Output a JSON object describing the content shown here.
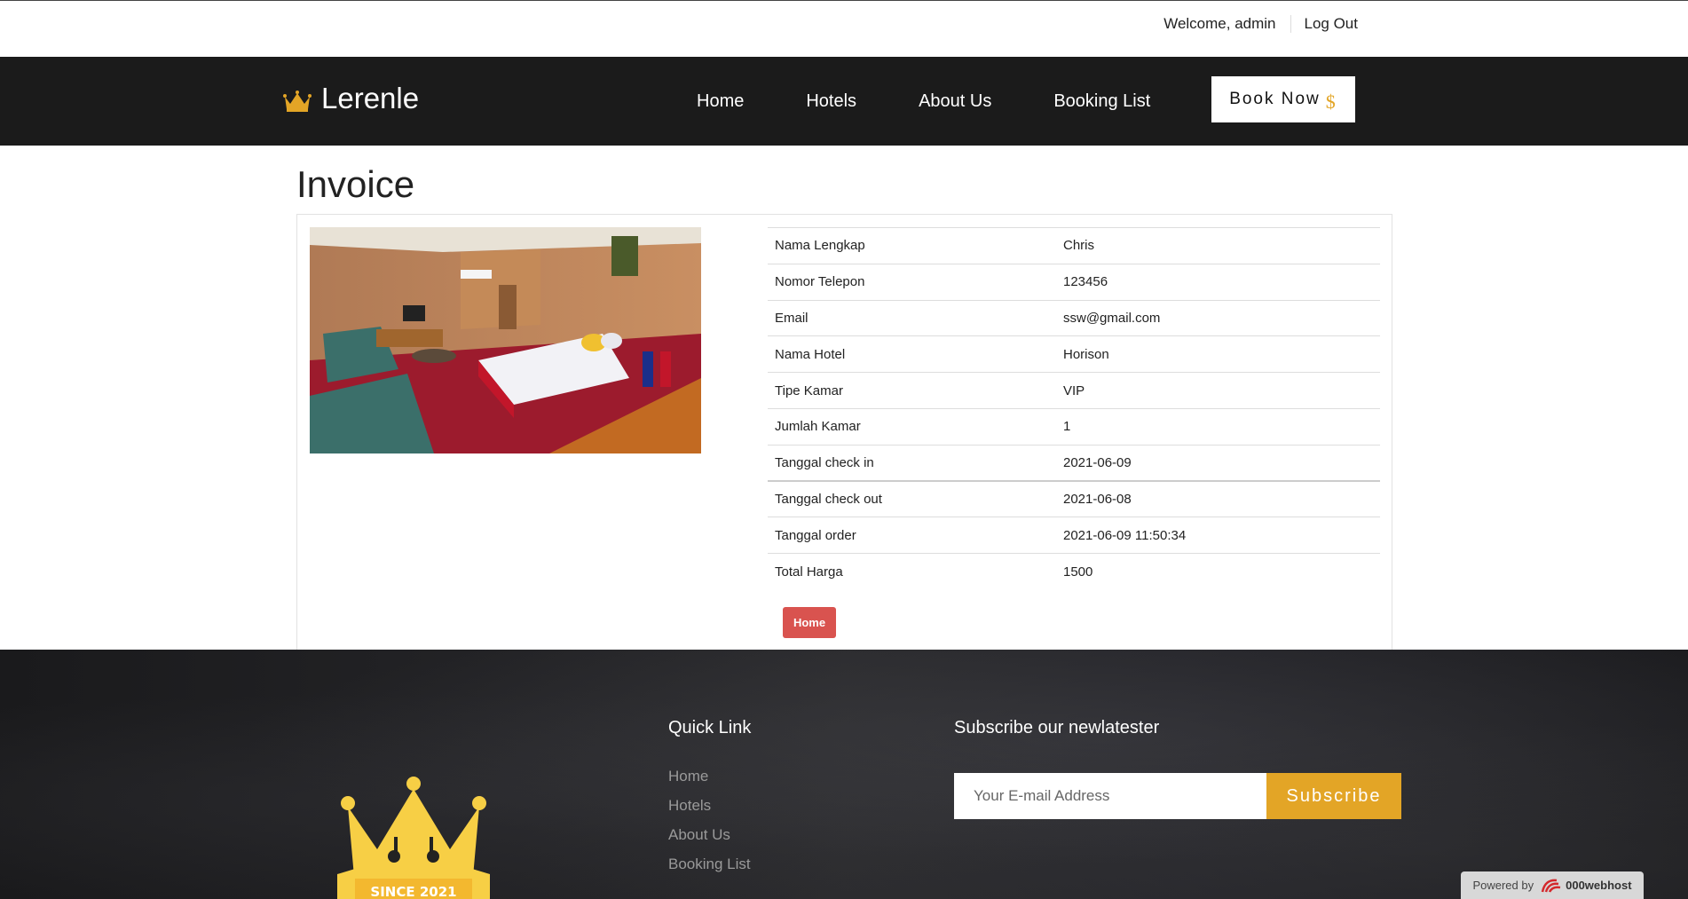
{
  "topbar": {
    "welcome": "Welcome, admin",
    "logout": "Log Out"
  },
  "nav": {
    "brand": "Lerenle",
    "links": [
      "Home",
      "Hotels",
      "About Us",
      "Booking List"
    ],
    "book_now": "Book Now",
    "book_now_icon": "$"
  },
  "page": {
    "title": "Invoice"
  },
  "invoice": {
    "rows": [
      {
        "label": "Nama Lengkap",
        "value": "Chris"
      },
      {
        "label": "Nomor Telepon",
        "value": "123456"
      },
      {
        "label": "Email",
        "value": "ssw@gmail.com"
      },
      {
        "label": "Nama Hotel",
        "value": "Horison"
      },
      {
        "label": "Tipe Kamar",
        "value": "VIP"
      },
      {
        "label": "Jumlah Kamar",
        "value": "1"
      },
      {
        "label": "Tanggal check in",
        "value": "2021-06-09"
      },
      {
        "label": "Tanggal check out",
        "value": "2021-06-08"
      },
      {
        "label": "Tanggal order",
        "value": "2021-06-09 11:50:34"
      },
      {
        "label": "Total Harga",
        "value": "1500"
      }
    ],
    "home_button": "Home"
  },
  "footer": {
    "logo_text": "SINCE 2021",
    "quick_link_title": "Quick Link",
    "quick_links": [
      "Home",
      "Hotels",
      "About Us",
      "Booking List"
    ],
    "subscribe_title": "Subscribe our newlatester",
    "email_placeholder": "Your E-mail Address",
    "subscribe_button": "Subscribe",
    "powered_by": "Powered by",
    "host_name": "000webhost"
  },
  "colors": {
    "accent": "#e3a526",
    "danger": "#d9534f",
    "nav_bg": "#1b1b1b"
  }
}
